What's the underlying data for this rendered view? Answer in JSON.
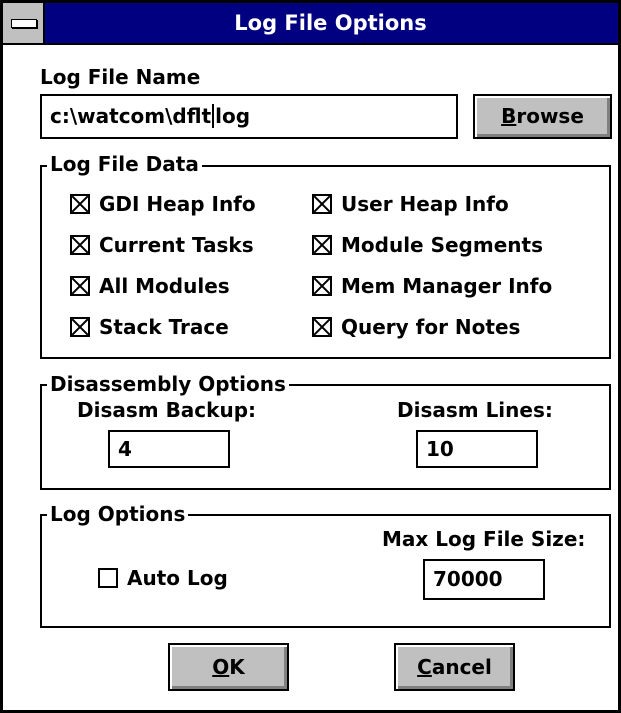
{
  "window": {
    "title": "Log File Options"
  },
  "log_file_name": {
    "label": "Log File Name",
    "value_before_caret": "c:\\watcom\\dflt",
    "value_after_caret": "log",
    "browse_label": "Browse",
    "browse_accel": "B",
    "browse_rest": "rowse"
  },
  "log_file_data": {
    "legend": "Log File Data",
    "items": [
      {
        "label": "GDI Heap Info",
        "checked": true
      },
      {
        "label": "User Heap Info",
        "checked": true
      },
      {
        "label": "Current Tasks",
        "checked": true
      },
      {
        "label": "Module Segments",
        "checked": true
      },
      {
        "label": "All Modules",
        "checked": true
      },
      {
        "label": "Mem Manager Info",
        "checked": true
      },
      {
        "label": "Stack Trace",
        "checked": true
      },
      {
        "label": "Query for Notes",
        "checked": true
      }
    ]
  },
  "disassembly": {
    "legend": "Disassembly Options",
    "backup_label": "Disasm Backup:",
    "backup_value": "4",
    "lines_label": "Disasm Lines:",
    "lines_value": "10"
  },
  "log_options": {
    "legend": "Log Options",
    "auto_log_label": "Auto Log",
    "auto_log_checked": false,
    "max_size_label": "Max Log File Size:",
    "max_size_value": "70000"
  },
  "buttons": {
    "ok_accel": "O",
    "ok_rest": "K",
    "cancel_accel": "C",
    "cancel_rest": "ancel"
  },
  "colors": {
    "titlebar": "#000080",
    "button_face": "#c0c0c0"
  }
}
